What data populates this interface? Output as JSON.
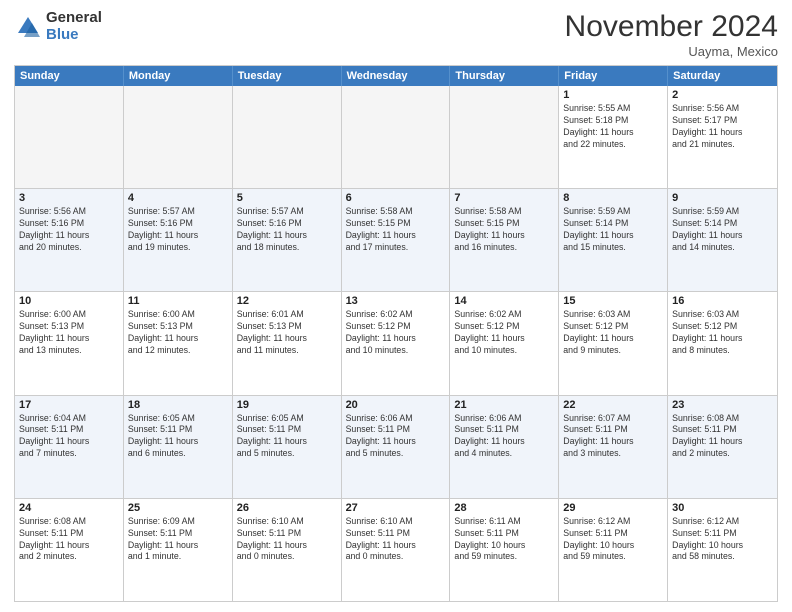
{
  "header": {
    "logo_general": "General",
    "logo_blue": "Blue",
    "month_title": "November 2024",
    "location": "Uayma, Mexico"
  },
  "weekdays": [
    "Sunday",
    "Monday",
    "Tuesday",
    "Wednesday",
    "Thursday",
    "Friday",
    "Saturday"
  ],
  "rows": [
    [
      {
        "day": "",
        "text": "",
        "empty": true
      },
      {
        "day": "",
        "text": "",
        "empty": true
      },
      {
        "day": "",
        "text": "",
        "empty": true
      },
      {
        "day": "",
        "text": "",
        "empty": true
      },
      {
        "day": "",
        "text": "",
        "empty": true
      },
      {
        "day": "1",
        "text": "Sunrise: 5:55 AM\nSunset: 5:18 PM\nDaylight: 11 hours\nand 22 minutes."
      },
      {
        "day": "2",
        "text": "Sunrise: 5:56 AM\nSunset: 5:17 PM\nDaylight: 11 hours\nand 21 minutes."
      }
    ],
    [
      {
        "day": "3",
        "text": "Sunrise: 5:56 AM\nSunset: 5:16 PM\nDaylight: 11 hours\nand 20 minutes."
      },
      {
        "day": "4",
        "text": "Sunrise: 5:57 AM\nSunset: 5:16 PM\nDaylight: 11 hours\nand 19 minutes."
      },
      {
        "day": "5",
        "text": "Sunrise: 5:57 AM\nSunset: 5:16 PM\nDaylight: 11 hours\nand 18 minutes."
      },
      {
        "day": "6",
        "text": "Sunrise: 5:58 AM\nSunset: 5:15 PM\nDaylight: 11 hours\nand 17 minutes."
      },
      {
        "day": "7",
        "text": "Sunrise: 5:58 AM\nSunset: 5:15 PM\nDaylight: 11 hours\nand 16 minutes."
      },
      {
        "day": "8",
        "text": "Sunrise: 5:59 AM\nSunset: 5:14 PM\nDaylight: 11 hours\nand 15 minutes."
      },
      {
        "day": "9",
        "text": "Sunrise: 5:59 AM\nSunset: 5:14 PM\nDaylight: 11 hours\nand 14 minutes."
      }
    ],
    [
      {
        "day": "10",
        "text": "Sunrise: 6:00 AM\nSunset: 5:13 PM\nDaylight: 11 hours\nand 13 minutes."
      },
      {
        "day": "11",
        "text": "Sunrise: 6:00 AM\nSunset: 5:13 PM\nDaylight: 11 hours\nand 12 minutes."
      },
      {
        "day": "12",
        "text": "Sunrise: 6:01 AM\nSunset: 5:13 PM\nDaylight: 11 hours\nand 11 minutes."
      },
      {
        "day": "13",
        "text": "Sunrise: 6:02 AM\nSunset: 5:12 PM\nDaylight: 11 hours\nand 10 minutes."
      },
      {
        "day": "14",
        "text": "Sunrise: 6:02 AM\nSunset: 5:12 PM\nDaylight: 11 hours\nand 10 minutes."
      },
      {
        "day": "15",
        "text": "Sunrise: 6:03 AM\nSunset: 5:12 PM\nDaylight: 11 hours\nand 9 minutes."
      },
      {
        "day": "16",
        "text": "Sunrise: 6:03 AM\nSunset: 5:12 PM\nDaylight: 11 hours\nand 8 minutes."
      }
    ],
    [
      {
        "day": "17",
        "text": "Sunrise: 6:04 AM\nSunset: 5:11 PM\nDaylight: 11 hours\nand 7 minutes."
      },
      {
        "day": "18",
        "text": "Sunrise: 6:05 AM\nSunset: 5:11 PM\nDaylight: 11 hours\nand 6 minutes."
      },
      {
        "day": "19",
        "text": "Sunrise: 6:05 AM\nSunset: 5:11 PM\nDaylight: 11 hours\nand 5 minutes."
      },
      {
        "day": "20",
        "text": "Sunrise: 6:06 AM\nSunset: 5:11 PM\nDaylight: 11 hours\nand 5 minutes."
      },
      {
        "day": "21",
        "text": "Sunrise: 6:06 AM\nSunset: 5:11 PM\nDaylight: 11 hours\nand 4 minutes."
      },
      {
        "day": "22",
        "text": "Sunrise: 6:07 AM\nSunset: 5:11 PM\nDaylight: 11 hours\nand 3 minutes."
      },
      {
        "day": "23",
        "text": "Sunrise: 6:08 AM\nSunset: 5:11 PM\nDaylight: 11 hours\nand 2 minutes."
      }
    ],
    [
      {
        "day": "24",
        "text": "Sunrise: 6:08 AM\nSunset: 5:11 PM\nDaylight: 11 hours\nand 2 minutes."
      },
      {
        "day": "25",
        "text": "Sunrise: 6:09 AM\nSunset: 5:11 PM\nDaylight: 11 hours\nand 1 minute."
      },
      {
        "day": "26",
        "text": "Sunrise: 6:10 AM\nSunset: 5:11 PM\nDaylight: 11 hours\nand 0 minutes."
      },
      {
        "day": "27",
        "text": "Sunrise: 6:10 AM\nSunset: 5:11 PM\nDaylight: 11 hours\nand 0 minutes."
      },
      {
        "day": "28",
        "text": "Sunrise: 6:11 AM\nSunset: 5:11 PM\nDaylight: 10 hours\nand 59 minutes."
      },
      {
        "day": "29",
        "text": "Sunrise: 6:12 AM\nSunset: 5:11 PM\nDaylight: 10 hours\nand 59 minutes."
      },
      {
        "day": "30",
        "text": "Sunrise: 6:12 AM\nSunset: 5:11 PM\nDaylight: 10 hours\nand 58 minutes."
      }
    ]
  ]
}
